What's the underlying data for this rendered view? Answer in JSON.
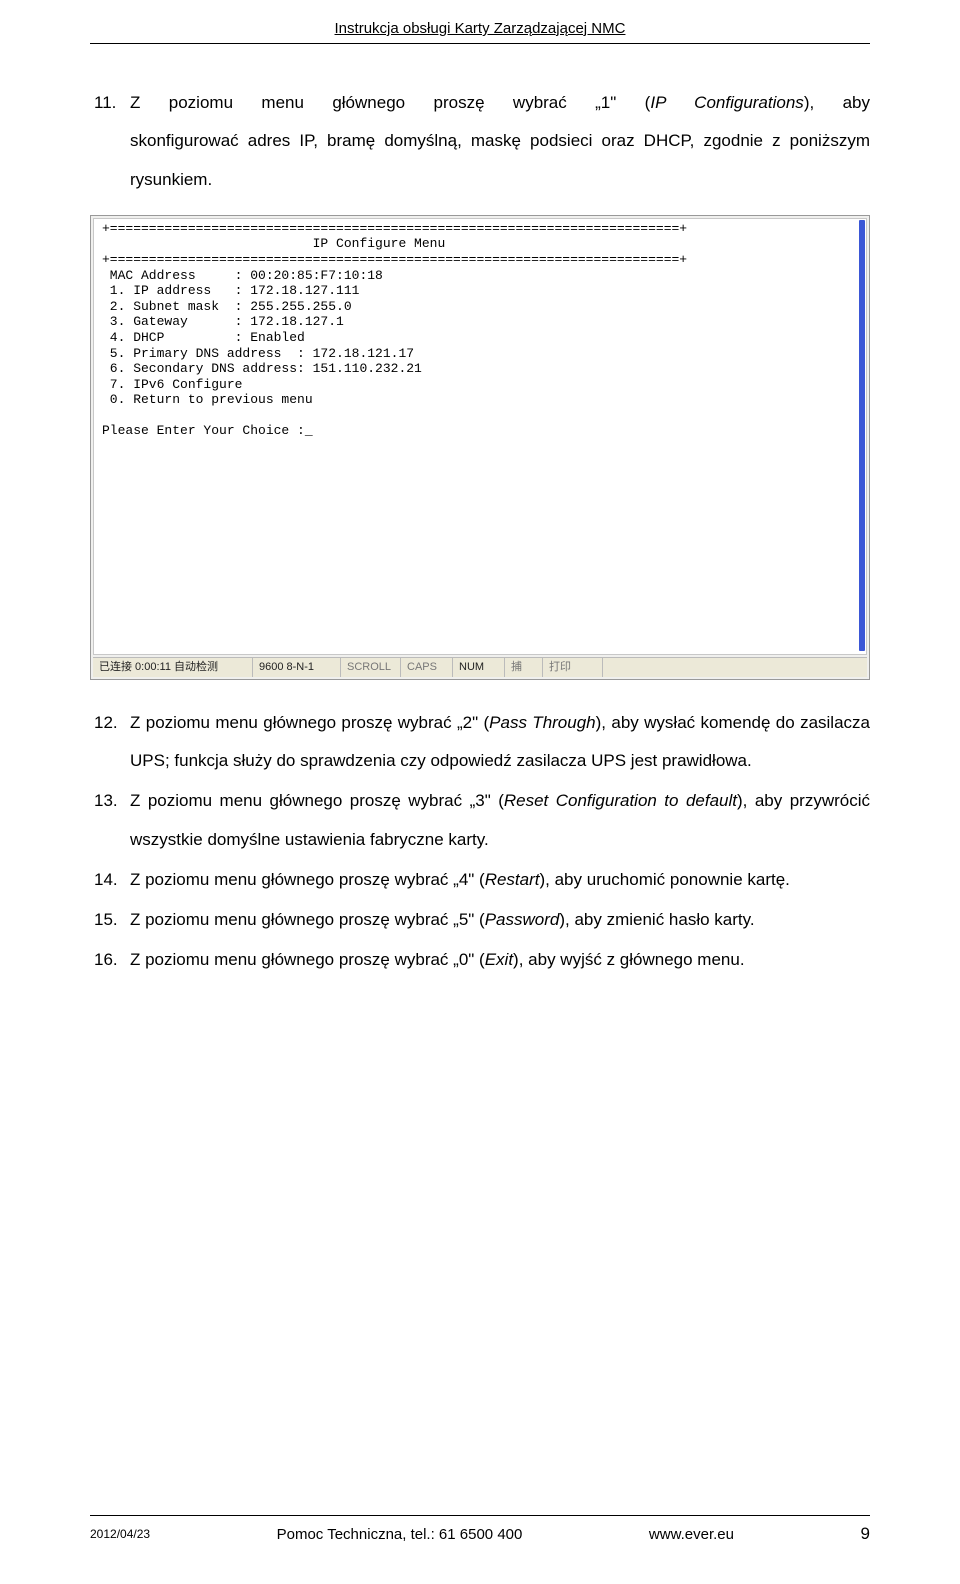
{
  "header": {
    "title": "Instrukcja obsługi Karty Zarządzającej NMC"
  },
  "list": {
    "item11": {
      "num": "11.",
      "line1_a": "Z poziomu menu głównego proszę wybrać „1\" (",
      "line1_italic": "IP Configurations",
      "line1_b": "), aby",
      "line2": "skonfigurować adres IP, bramę domyślną, maskę podsieci oraz DHCP, zgodnie z poniższym rysunkiem."
    },
    "item12": {
      "num": "12.",
      "a": "Z poziomu menu głównego proszę wybrać „2\" (",
      "i": "Pass Through",
      "b": "), aby wysłać komendę do zasilacza UPS; funkcja służy do sprawdzenia czy odpowiedź zasilacza UPS jest prawidłowa."
    },
    "item13": {
      "num": "13.",
      "a": "Z poziomu menu głównego proszę wybrać „3\" (",
      "i": "Reset Configuration to default",
      "b": "), aby przywrócić wszystkie domyślne ustawienia fabryczne karty."
    },
    "item14": {
      "num": "14.",
      "a": "Z poziomu menu głównego proszę wybrać „4\" (",
      "i": "Restart",
      "b": "), aby uruchomić ponownie kartę."
    },
    "item15": {
      "num": "15.",
      "a": "Z poziomu menu głównego proszę wybrać „5\" (",
      "i": "Password",
      "b": "), aby zmienić hasło karty."
    },
    "item16": {
      "num": "16.",
      "a": "Z poziomu menu głównego proszę wybrać „0\" (",
      "i": "Exit",
      "b": "), aby wyjść z głównego menu."
    }
  },
  "terminal": {
    "sep": "+=========================================================================+",
    "title": "                           IP Configure Menu",
    "mac": " MAC Address     : 00:20:85:F7:10:18",
    "l1": " 1. IP address   : 172.18.127.111",
    "l2": " 2. Subnet mask  : 255.255.255.0",
    "l3": " 3. Gateway      : 172.18.127.1",
    "l4": " 4. DHCP         : Enabled",
    "l5": " 5. Primary DNS address  : 172.18.121.17",
    "l6": " 6. Secondary DNS address: 151.110.232.21",
    "l7": " 7. IPv6 Configure",
    "l0": " 0. Return to previous menu",
    "prompt": "Please Enter Your Choice :_"
  },
  "status": {
    "c1": "已连接 0:00:11 自动检测",
    "c2": "9600 8-N-1",
    "c3": "SCROLL",
    "c4": "CAPS",
    "c5": "NUM",
    "c6": "捕",
    "c7": "打印"
  },
  "footer": {
    "date": "2012/04/23",
    "center": "Pomoc Techniczna, tel.: 61 6500 400",
    "right": "www.ever.eu",
    "pagenum": "9"
  }
}
